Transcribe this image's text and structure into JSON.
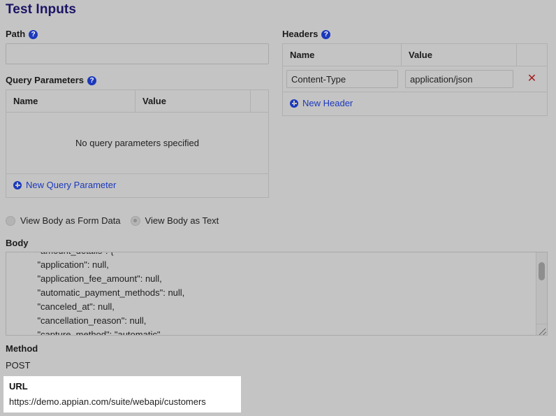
{
  "page": {
    "title": "Test Inputs",
    "background_color": "#c4c4c4",
    "title_color": "#1b1464",
    "link_color": "#1c39bb",
    "delete_color": "#a32020"
  },
  "path": {
    "label": "Path",
    "help_icon": "help-circle-icon",
    "value": "",
    "placeholder": ""
  },
  "query_parameters": {
    "label": "Query Parameters",
    "help_icon": "help-circle-icon",
    "columns": [
      "Name",
      "Value"
    ],
    "rows": [],
    "empty_message": "No query parameters specified",
    "add_label": "New Query Parameter",
    "add_icon": "plus-circle-icon"
  },
  "headers": {
    "label": "Headers",
    "help_icon": "help-circle-icon",
    "columns": [
      "Name",
      "Value"
    ],
    "rows": [
      {
        "name": "Content-Type",
        "value": "application/json",
        "delete_icon": "close-x-icon",
        "delete_glyph": "✕"
      }
    ],
    "add_label": "New Header",
    "add_icon": "plus-circle-icon"
  },
  "body_view": {
    "options": [
      {
        "label": "View Body as Form Data",
        "selected": false
      },
      {
        "label": "View Body as Text",
        "selected": true
      }
    ]
  },
  "body": {
    "label": "Body",
    "text": "    \"amount_details\": {\n    \"application\": null,\n    \"application_fee_amount\": null,\n    \"automatic_payment_methods\": null,\n    \"canceled_at\": null,\n    \"cancellation_reason\": null,\n    \"capture_method\": \"automatic\",",
    "scrollbar": "vertical-scrollbar",
    "resize_handle": "resize-grip-icon"
  },
  "method": {
    "label": "Method",
    "value": "POST"
  },
  "url": {
    "label": "URL",
    "value": "https://demo.appian.com/suite/webapi/customers"
  }
}
